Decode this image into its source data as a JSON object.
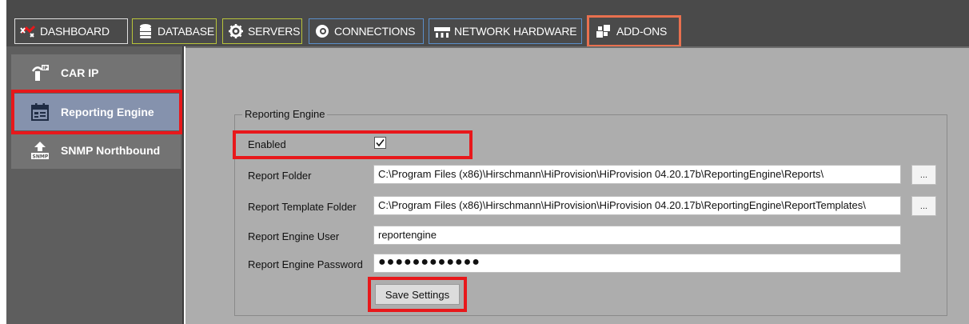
{
  "nav": {
    "tabs": [
      {
        "label": "DASHBOARD",
        "icon": "dashboard-icon",
        "border": "#e0e0e0"
      },
      {
        "label": "DATABASE",
        "icon": "database-icon",
        "border": "#b8c43a"
      },
      {
        "label": "SERVERS",
        "icon": "servers-icon",
        "border": "#b8c43a"
      },
      {
        "label": "CONNECTIONS",
        "icon": "connections-icon",
        "border": "#5b8ec9"
      },
      {
        "label": "NETWORK HARDWARE",
        "icon": "network-hardware-icon",
        "border": "#5b8ec9"
      },
      {
        "label": "ADD-ONS",
        "icon": "addons-icon",
        "border": "#e8704f",
        "active": true
      }
    ]
  },
  "sidebar": {
    "items": [
      {
        "label": "CAR IP",
        "icon": "car-ip-icon"
      },
      {
        "label": "Reporting Engine",
        "icon": "reporting-engine-icon",
        "selected": true
      },
      {
        "label": "SNMP Northbound",
        "icon": "snmp-northbound-icon"
      }
    ]
  },
  "reporting": {
    "group_title": "Reporting Engine",
    "enabled_label": "Enabled",
    "enabled": true,
    "report_folder_label": "Report Folder",
    "report_folder_value": "C:\\Program Files (x86)\\Hirschmann\\HiProvision\\HiProvision 04.20.17b\\ReportingEngine\\Reports\\",
    "template_folder_label": "Report Template Folder",
    "template_folder_value": "C:\\Program Files (x86)\\Hirschmann\\HiProvision\\HiProvision 04.20.17b\\ReportingEngine\\ReportTemplates\\",
    "user_label": "Report Engine User",
    "user_value": "reportengine",
    "password_label": "Report Engine Password",
    "password_value": "●●●●●●●●●●●●",
    "browse_label": "...",
    "save_label": "Save Settings"
  },
  "colors": {
    "highlight": "#e8181b",
    "selected_item": "#8592ad",
    "panel_bg": "#adadad"
  }
}
